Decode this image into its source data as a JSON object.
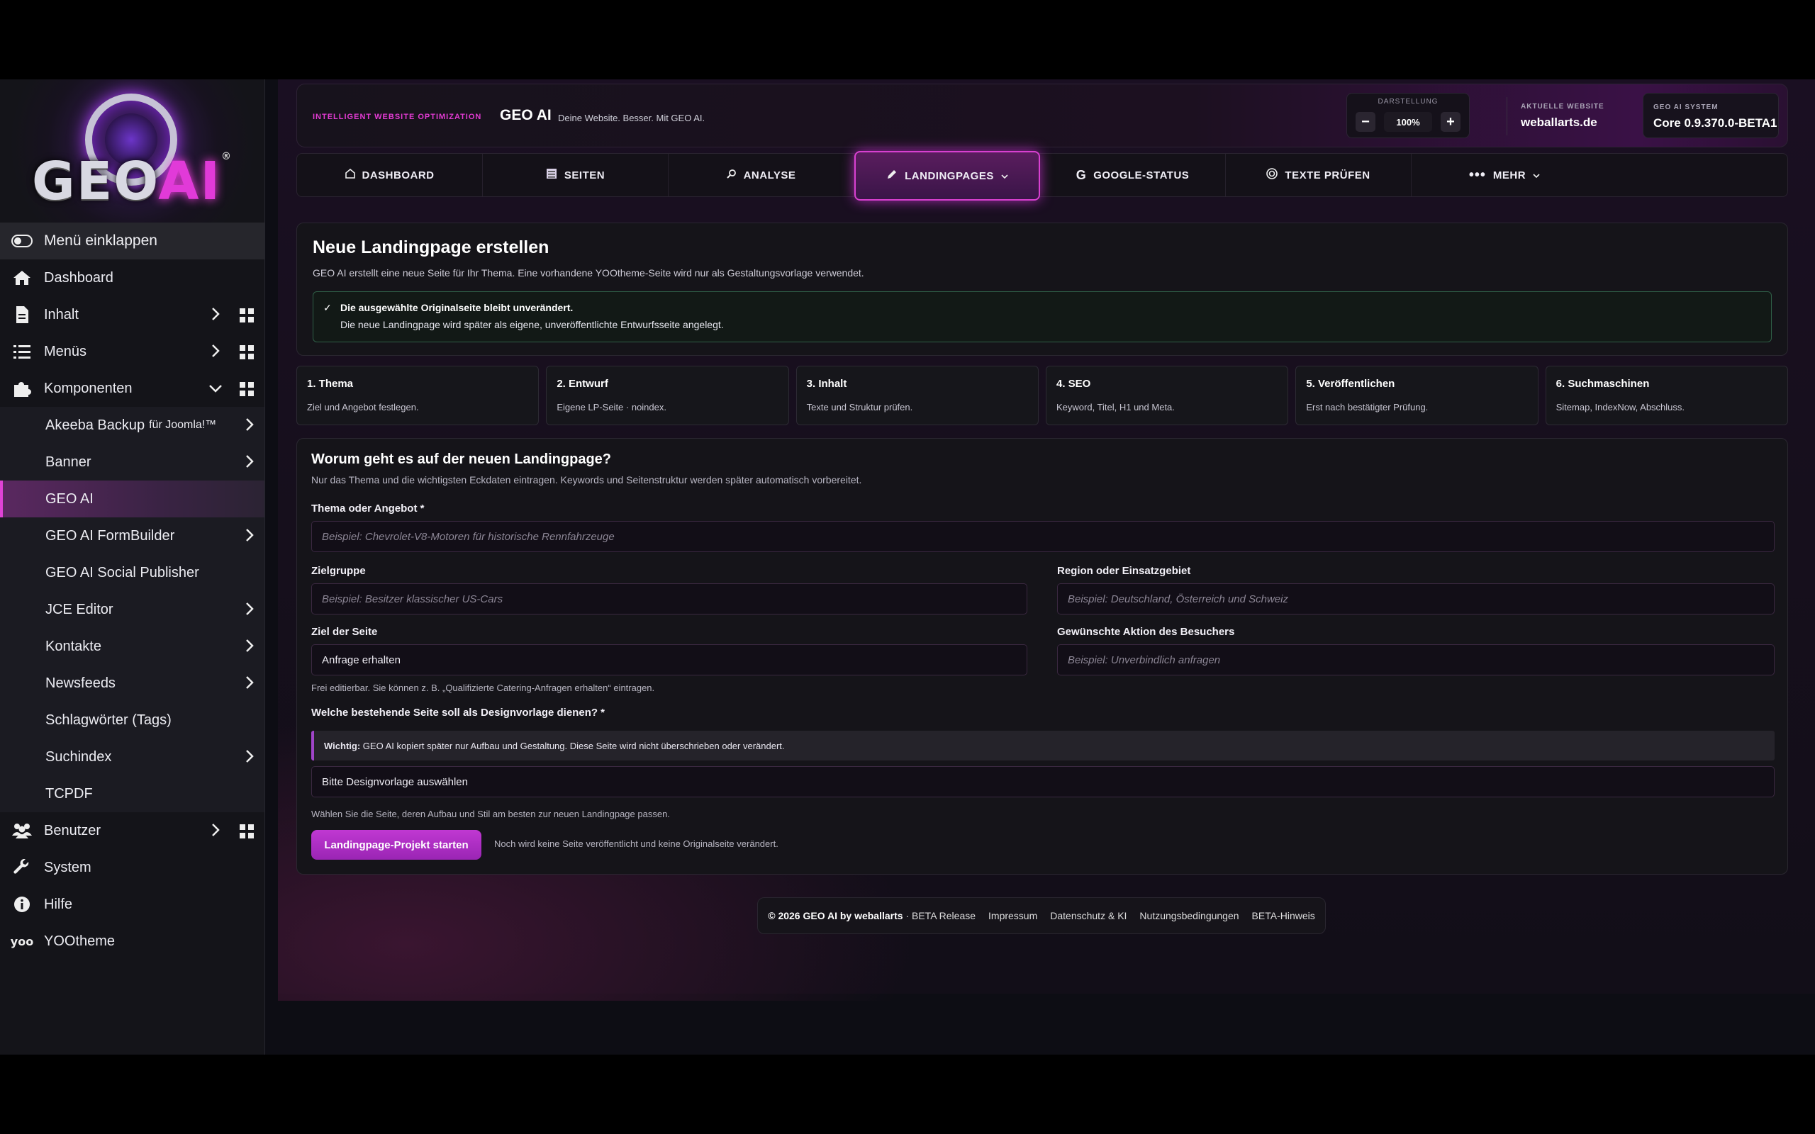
{
  "sidebar": {
    "logo": {
      "geo": "GEO",
      "ai": "AI",
      "reg": "®"
    },
    "collapse_label": "Menü einklappen",
    "items": [
      {
        "label": "Dashboard"
      },
      {
        "label": "Inhalt"
      },
      {
        "label": "Menüs"
      },
      {
        "label": "Komponenten"
      }
    ],
    "components": [
      {
        "label": "Akeeba Backup",
        "suffix": "für Joomla!™"
      },
      {
        "label": "Banner"
      },
      {
        "label": "GEO AI"
      },
      {
        "label": "GEO AI FormBuilder"
      },
      {
        "label": "GEO AI Social Publisher"
      },
      {
        "label": "JCE Editor"
      },
      {
        "label": "Kontakte"
      },
      {
        "label": "Newsfeeds"
      },
      {
        "label": "Schlagwörter (Tags)"
      },
      {
        "label": "Suchindex"
      },
      {
        "label": "TCPDF"
      }
    ],
    "bottom": [
      {
        "label": "Benutzer"
      },
      {
        "label": "System"
      },
      {
        "label": "Hilfe"
      },
      {
        "label": "YOOtheme"
      }
    ]
  },
  "header": {
    "kicker": "INTELLIGENT WEBSITE OPTIMIZATION",
    "title": "GEO AI",
    "subtitle": "Deine Website. Besser. Mit GEO AI.",
    "zoom_label": "DARSTELLUNG",
    "zoom_value": "100%",
    "site_label": "AKTUELLE WEBSITE",
    "site_value": "weballarts.de",
    "system_label": "GEO AI SYSTEM",
    "system_value": "Core 0.9.370.0-BETA1"
  },
  "tabs": [
    {
      "label": "DASHBOARD"
    },
    {
      "label": "SEITEN"
    },
    {
      "label": "ANALYSE"
    },
    {
      "label": "LANDINGPAGES"
    },
    {
      "label": "GOOGLE-STATUS"
    },
    {
      "label": "TEXTE PRÜFEN"
    },
    {
      "label": "MEHR"
    }
  ],
  "intro": {
    "title": "Neue Landingpage erstellen",
    "text": "GEO AI erstellt eine neue Seite für Ihr Thema. Eine vorhandene YOOtheme-Seite wird nur als Gestaltungsvorlage verwendet.",
    "notice_bold": "Die ausgewählte Originalseite bleibt unverändert.",
    "notice_text": "Die neue Landingpage wird später als eigene, unveröffentlichte Entwurfsseite angelegt."
  },
  "steps": [
    {
      "title": "1. Thema",
      "desc": "Ziel und Angebot festlegen."
    },
    {
      "title": "2. Entwurf",
      "desc": "Eigene LP-Seite · noindex."
    },
    {
      "title": "3. Inhalt",
      "desc": "Texte und Struktur prüfen."
    },
    {
      "title": "4. SEO",
      "desc": "Keyword, Titel, H1 und Meta."
    },
    {
      "title": "5. Veröffentlichen",
      "desc": "Erst nach bestätigter Prüfung."
    },
    {
      "title": "6. Suchmaschinen",
      "desc": "Sitemap, IndexNow, Abschluss."
    }
  ],
  "form": {
    "title": "Worum geht es auf der neuen Landingpage?",
    "subtitle": "Nur das Thema und die wichtigsten Eckdaten eintragen. Keywords und Seitenstruktur werden später automatisch vorbereitet.",
    "topic_label": "Thema oder Angebot *",
    "topic_placeholder": "Beispiel: Chevrolet-V8-Motoren für historische Rennfahrzeuge",
    "audience_label": "Zielgruppe",
    "audience_placeholder": "Beispiel: Besitzer klassischer US-Cars",
    "region_label": "Region oder Einsatzgebiet",
    "region_placeholder": "Beispiel: Deutschland, Österreich und Schweiz",
    "goal_label": "Ziel der Seite",
    "goal_value": "Anfrage erhalten",
    "action_label": "Gewünschte Aktion des Besuchers",
    "action_placeholder": "Beispiel: Unverbindlich anfragen",
    "goal_hint": "Frei editierbar. Sie können z. B. „Qualifizierte Catering-Anfragen erhalten“ eintragen.",
    "template_label": "Welche bestehende Seite soll als Designvorlage dienen? *",
    "warn_bold": "Wichtig:",
    "warn_text": "GEO AI kopiert später nur Aufbau und Gestaltung. Diese Seite wird nicht überschrieben oder verändert.",
    "template_value": "Bitte Designvorlage auswählen",
    "template_hint": "Wählen Sie die Seite, deren Aufbau und Stil am besten zur neuen Landingpage passen.",
    "cta_label": "Landingpage-Projekt starten",
    "cta_note": "Noch wird keine Seite veröffentlicht und keine Originalseite verändert."
  },
  "footer": {
    "copyright": "© 2026 GEO AI by weballarts",
    "release": "· BETA Release",
    "links": [
      "Impressum",
      "Datenschutz & KI",
      "Nutzungsbedingungen",
      "BETA-Hinweis"
    ]
  }
}
